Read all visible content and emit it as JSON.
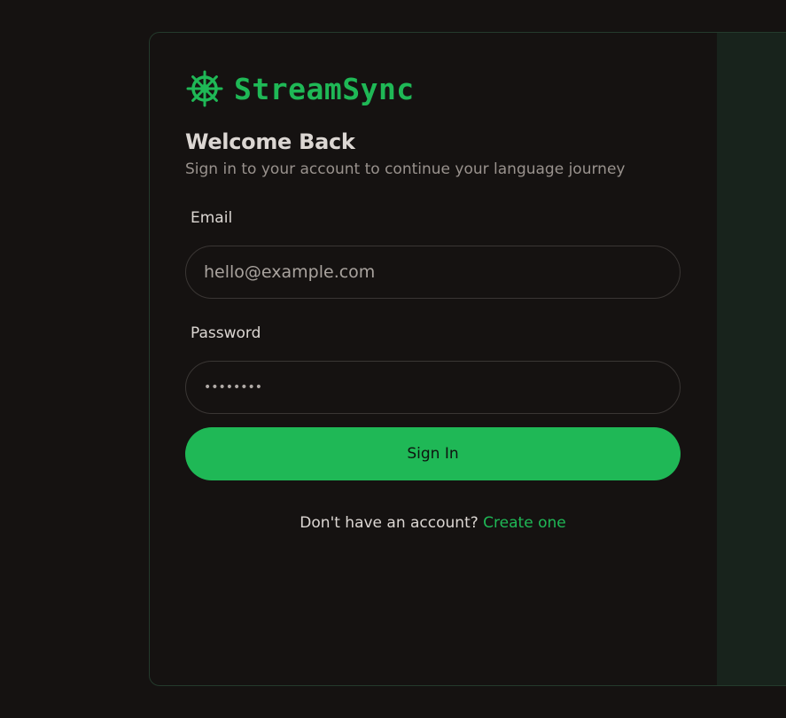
{
  "brand": {
    "name": "StreamSync",
    "icon": "helm-wheel-icon",
    "accent_color": "#1fb856"
  },
  "form": {
    "title": "Welcome Back",
    "subtitle": "Sign in to your account to continue your language journey",
    "email": {
      "label": "Email",
      "placeholder": "hello@example.com",
      "value": ""
    },
    "password": {
      "label": "Password",
      "value": "••••••••"
    },
    "submit_label": "Sign In"
  },
  "footer": {
    "prompt": "Don't have an account?",
    "link_label": "Create one"
  }
}
